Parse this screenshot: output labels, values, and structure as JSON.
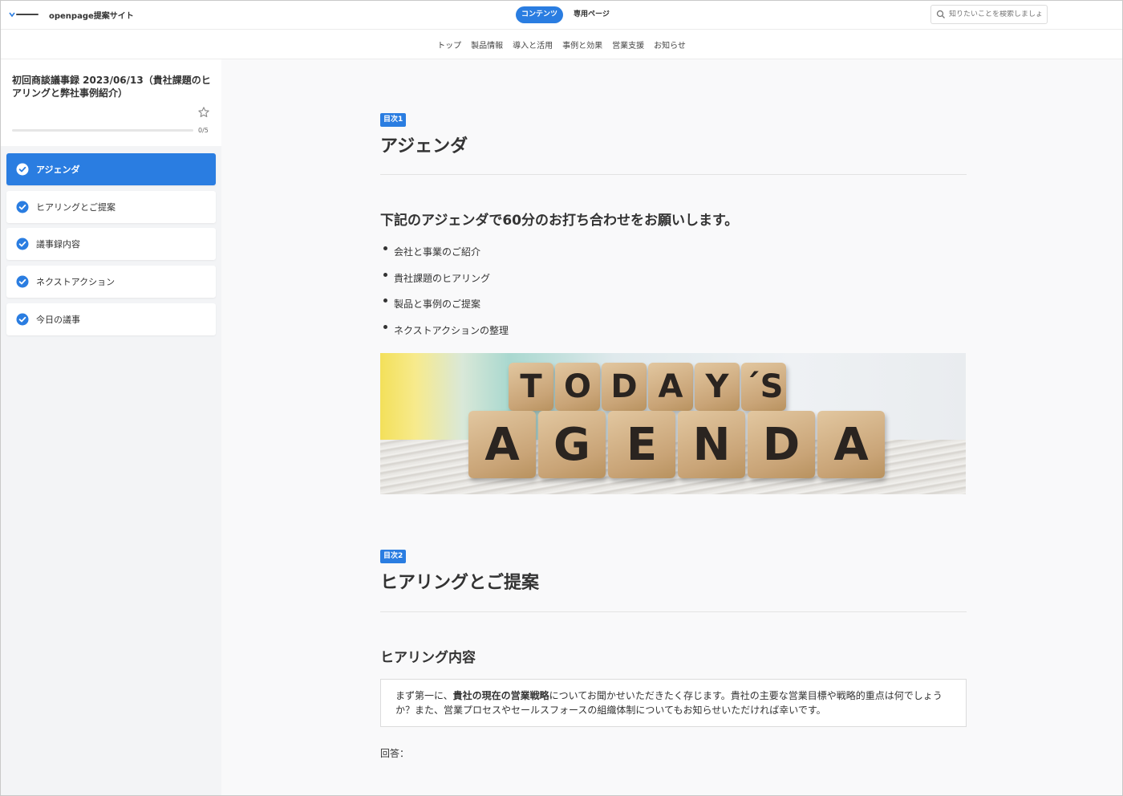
{
  "header": {
    "site_name": "openpage提案サイト",
    "tabs": [
      {
        "label": "コンテンツ",
        "active": true
      },
      {
        "label": "専用ページ",
        "active": false
      }
    ],
    "search_placeholder": "知りたいことを検索しましょう",
    "accent_color": "#2a7de1"
  },
  "subnav": [
    "トップ",
    "製品情報",
    "導入と活用",
    "事例と効果",
    "営業支援",
    "お知らせ"
  ],
  "sidebar": {
    "title": "初回商談議事録 2023/06/13（貴社課題のヒアリングと弊社事例紹介）",
    "progress_text": "0/5",
    "progress_fraction": 0,
    "items": [
      {
        "label": "アジェンダ",
        "active": true
      },
      {
        "label": "ヒアリングとご提案",
        "active": false
      },
      {
        "label": "議事録内容",
        "active": false
      },
      {
        "label": "ネクストアクション",
        "active": false
      },
      {
        "label": "今日の議事",
        "active": false
      }
    ]
  },
  "main": {
    "section1": {
      "badge": "目次1",
      "title": "アジェンダ",
      "lead": "下記のアジェンダで60分のお打ち合わせをお願いします。",
      "bullets": [
        "会社と事業のご紹介",
        "貴社課題のヒアリング",
        "製品と事例のご提案",
        "ネクストアクションの整理"
      ],
      "image_row1": [
        "T",
        "O",
        "D",
        "A",
        "Y",
        "´S"
      ],
      "image_row2": [
        "A",
        "G",
        "E",
        "N",
        "D",
        "A"
      ]
    },
    "section2": {
      "badge": "目次2",
      "title": "ヒアリングとご提案",
      "subheading": "ヒアリング内容",
      "question_prefix": "まず第一に、",
      "question_bold": "貴社の現在の営業戦略",
      "question_rest": "についてお聞かせいただきたく存じます。貴社の主要な営業目標や戦略的重点は何でしょうか？また、営業プロセスやセールスフォースの組織体制についてもお知らせいただければ幸いです。",
      "answer_label": "回答："
    }
  }
}
